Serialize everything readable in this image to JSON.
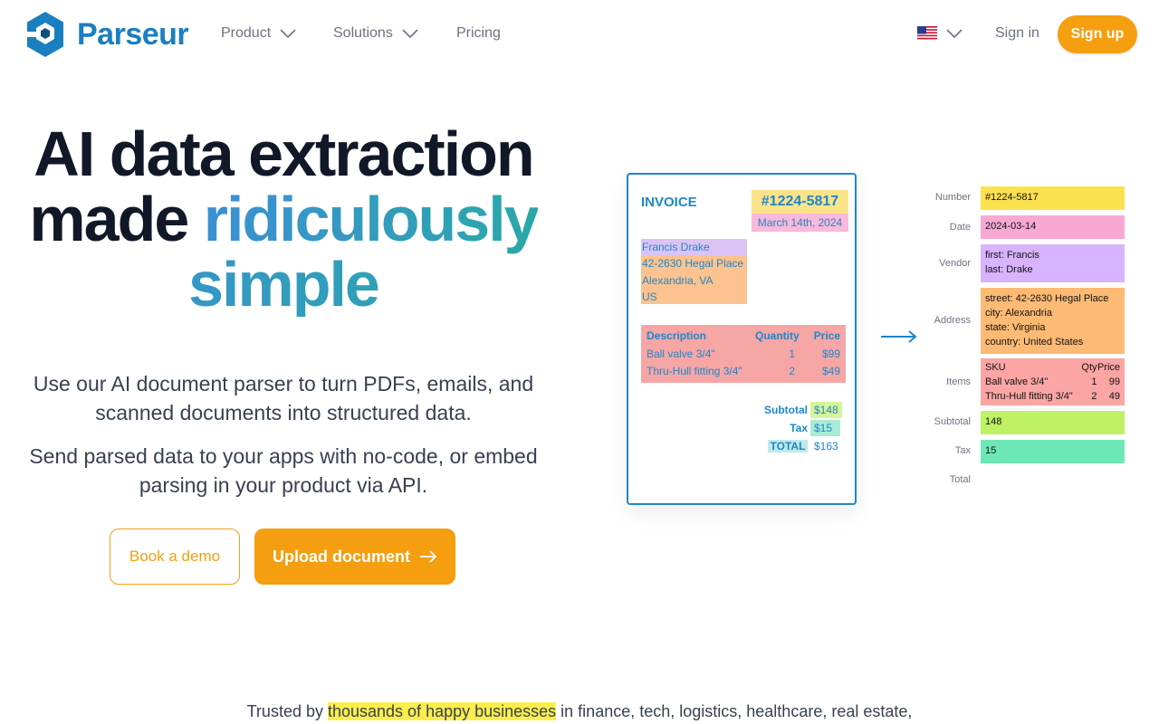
{
  "nav": {
    "brand": "Parseur",
    "product_label": "Product",
    "solutions_label": "Solutions",
    "pricing_label": "Pricing",
    "signin_label": "Sign in",
    "signup_label": "Sign up",
    "language_icon": "us-flag-icon"
  },
  "hero": {
    "title_line1": "AI data extraction",
    "title_line2_plain": "made ",
    "title_line2_grad": "ridiculously",
    "title_line3": "simple",
    "subtitle1": "Use our AI document parser to turn PDFs, emails, and scanned documents into structured data.",
    "subtitle2": "Send parsed data to your apps with no-code, or embed parsing in your product via API.",
    "demo_button": "Book a demo",
    "upload_button": "Upload document"
  },
  "invoice": {
    "title": "INVOICE",
    "number": "#1224-5817",
    "date": "March 14th, 2024",
    "vendor": "Francis Drake",
    "address_lines": [
      "42-2630 Hegal Place",
      "Alexandria, VA",
      "US"
    ],
    "table_header": {
      "description": "Description",
      "quantity": "Quantity",
      "price": "Price"
    },
    "items": [
      {
        "description": "Ball valve 3/4\"",
        "quantity": "1",
        "price": "$99"
      },
      {
        "description": "Thru-Hull fitting 3/4\"",
        "quantity": "2",
        "price": "$49"
      }
    ],
    "subtotal_label": "Subtotal",
    "subtotal_value": "$148",
    "tax_label": "Tax",
    "tax_value": "$15",
    "total_label": "TOTAL",
    "total_value": "$163"
  },
  "extracted": {
    "number_label": "Number",
    "number_value": "#1224-5817",
    "date_label": "Date",
    "date_value": "2024-03-14",
    "vendor_label": "Vendor",
    "vendor_first": "first: Francis",
    "vendor_last": "last: Drake",
    "address_label": "Address",
    "address_street": "street: 42-2630 Hegal Place",
    "address_city": "city: Alexandria",
    "address_state": "state: Virginia",
    "address_country": "country: United States",
    "items_label": "Items",
    "items_header": {
      "sku": "SKU",
      "qty": "Qty",
      "price": "Price"
    },
    "items": [
      {
        "sku": "Ball valve 3/4\"",
        "qty": "1",
        "price": "99"
      },
      {
        "sku": "Thru-Hull fitting 3/4\"",
        "qty": "2",
        "price": "49"
      }
    ],
    "subtotal_label": "Subtotal",
    "subtotal_value": "148",
    "tax_label": "Tax",
    "tax_value": "15",
    "total_label": "Total"
  },
  "trusted": {
    "prefix": "Trusted by ",
    "highlight": "thousands of happy businesses",
    "suffix": " in finance, tech, logistics, healthcare, real estate,"
  },
  "colors": {
    "brand_blue": "#1a7fc1",
    "accent_orange": "#f49e10",
    "field_yellow": "#fce38a",
    "field_pink": "#f9b9da",
    "field_purple": "#dcc3f5",
    "field_orange": "#fcc28f",
    "field_red": "#f7a6a6",
    "field_green": "#bff06a",
    "field_teal": "#74e6bc"
  }
}
